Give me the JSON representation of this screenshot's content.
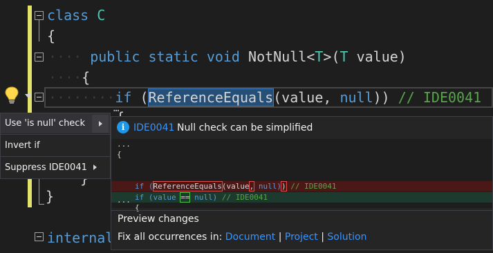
{
  "editor": {
    "line1": {
      "kw": "class",
      "name": "C"
    },
    "line2": "{",
    "line3": {
      "public": "public",
      "static": "static",
      "void": "void",
      "method": "NotNull",
      "lt": "<",
      "T": "T",
      "gt": ">(",
      "paramT": "T",
      "param": " value)"
    },
    "line4": "{",
    "line5": {
      "if": "if",
      "open": " (",
      "call": "ReferenceEquals",
      "args": "(value, ",
      "null": "null",
      "close": ")) ",
      "comment": "// IDE0041"
    },
    "line6": "{",
    "line7": "}",
    "line8": "}",
    "line9": {
      "kw": "internal"
    }
  },
  "lightbulb": {
    "icon": "lightbulb-icon",
    "dropdown": "chevron-down-icon"
  },
  "menu": {
    "items": [
      {
        "label": "Use 'is null' check",
        "has_submenu": true
      },
      {
        "label": "Invert if",
        "has_submenu": false
      },
      {
        "label": "Suppress IDE0041",
        "has_submenu": true
      }
    ]
  },
  "preview": {
    "id_link": "IDE0041",
    "title": "Null check can be simplified",
    "code": {
      "l1": "...",
      "l2": "{",
      "rem_if": "if (",
      "rem_call": "ReferenceEquals",
      "rem_a": "(value",
      "rem_comma": ",",
      "rem_null": " null)",
      "rem_paren": ")",
      "rem_comment": " // IDE0041",
      "add_if": "if (value ",
      "add_eq": "==",
      "add_null": " null)",
      "add_comment": " // IDE0041",
      "l5": "{",
      "l6": "..."
    },
    "preview_changes": "Preview changes",
    "fix_all_prefix": "Fix all occurrences in:",
    "fix_document": "Document",
    "fix_project": "Project",
    "fix_solution": "Solution",
    "divider": "|"
  },
  "colors": {
    "keyword": "#569cd6",
    "type": "#4ec9b0",
    "comment": "#57a64a",
    "link": "#3794ff",
    "selection": "#264f78"
  }
}
